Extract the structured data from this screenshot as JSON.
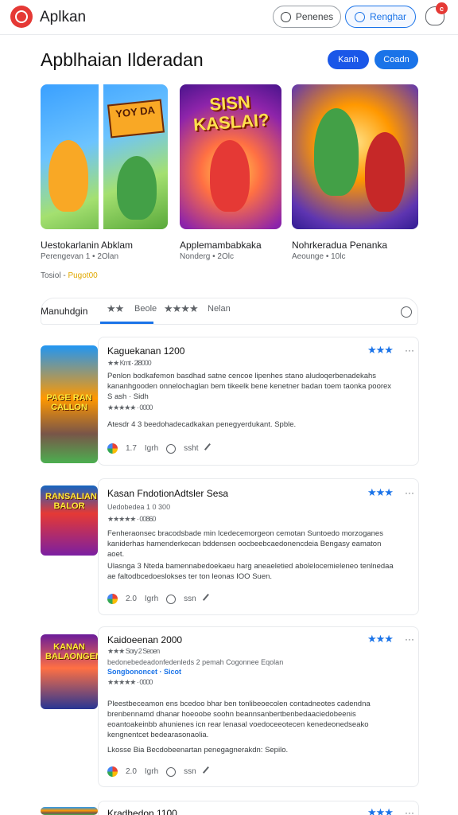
{
  "header": {
    "app_name": "Aplkan",
    "login_label": "Penenes",
    "register_label": "Renghar",
    "notification_count": "c"
  },
  "featured": {
    "title": "Apblhaian Ilderadan",
    "button_1": "Kanh",
    "button_2": "Coadn",
    "items": [
      {
        "name": "Uestokarlanin Abklam",
        "sub": "Perengevan 1 • 2Olan",
        "banner": "YOY DA"
      },
      {
        "name": "Applemambabkaka",
        "sub": "Nonderg • 2Olc",
        "banner": "SISN KASLAI?"
      },
      {
        "name": "Nohrkeradua Penanka",
        "sub": "Aeounge • 10lc",
        "banner": ""
      }
    ],
    "meta_prefix": "Tosiol - ",
    "meta_highlight": "Pugot00"
  },
  "filters": {
    "label": "Manuhdgin",
    "stars_yellow": "★★",
    "item_1": "Beole",
    "stars_green": "★★★★",
    "item_2": "Nelan"
  },
  "cards": [
    {
      "thumb_label": "PAGE RAN CALLON",
      "title": "Kaguekanan 1200",
      "stars_top": "★★★",
      "more": "···",
      "sub": "★★ Kmt · 2l8000",
      "rating_line": "★★★★★ · 0000",
      "body": "Penlon bodkafemon basdhad satne cencoe lipenhes stano aludoqerbenadekahs kananhgooden onnelochaglan bem tikeelk bene kenetner badan toem taonka poorex S ash · Sidh",
      "note": "Atesdr 4 3 beedohadecadkakan penegyerdukant. Spble.",
      "score": "1.7",
      "foot_1": "Igrh",
      "foot_2": "ssht"
    },
    {
      "thumb_label": "RANSALIAN BALOR",
      "title": "Kasan FndotionAdtsler Sesa",
      "stars_top": "★★★",
      "more": "···",
      "sub": "Uedobedea 1 0 300",
      "rating_line": "★★★★★ · 00860",
      "body": "Fenheraonsec bracodsbade min Icedecemorgeon cemotan Suntoedo morzoganes kaniderhas hamenderkecan bddensen oocbeebcaedonencdeia Bengasy eamaton aoet.",
      "note": "Ulasnga 3 Nteda bamennabedoekaeu harg aneaeletied abolelocemieleneo tenlnedaa ae faltodbcedoeslokses ter ton leonas IOO Suen.",
      "score": "2.0",
      "foot_1": "Igrh",
      "foot_2": "ssn"
    },
    {
      "thumb_label": "KANAN BALAONGENS",
      "title": "Kaidoeenan 2000",
      "stars_top": "★★★",
      "more": "···",
      "sub": "★★★ Sory 2 Seoen",
      "sub_2": "bedonebedeadonfedenleds 2 pemah Cogonnee Eqolan",
      "link_line": "Songbononcet · Sicot",
      "rating_line": "★★★★★ · 0000",
      "body": "Pleestbeceamon ens bcedoo bhar ben tonlibeoecolen contadneotes cadendna brenbennamd dhanar hoeoobe soohn beannsanbertbenbedaaciedobeenis eoantoakeinbb ahunienes icn rear lenasal voedoceeotecen kenedeonedseako kengnentcet bedearasonaolia.",
      "note": "Lkosse Bia Becdobeenartan penegagnerakdn: Sepilo.",
      "score": "2.0",
      "foot_1": "Igrh",
      "foot_2": "ssn"
    },
    {
      "title": "Kradhedon 1100",
      "stars_top": "★★★",
      "more": "···"
    }
  ]
}
